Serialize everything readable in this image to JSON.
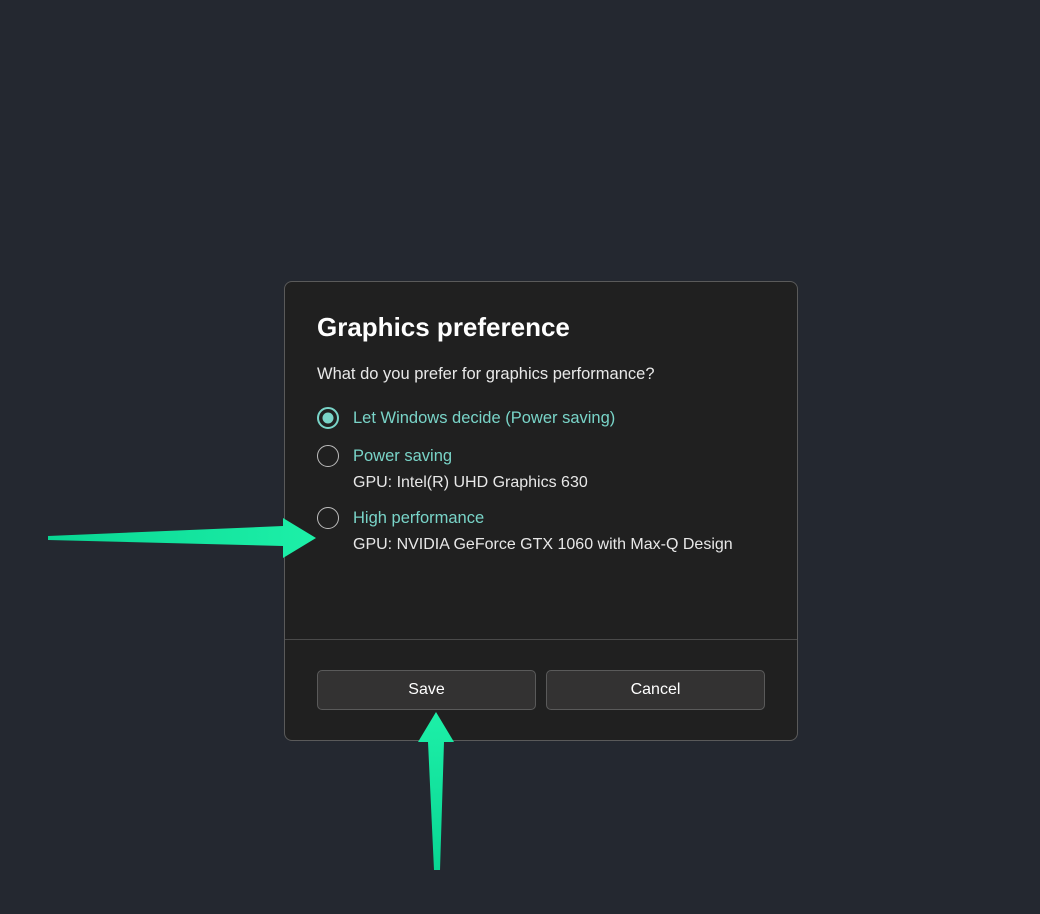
{
  "dialog": {
    "title": "Graphics preference",
    "question": "What do you prefer for graphics performance?",
    "options": [
      {
        "label": "Let Windows decide (Power saving)",
        "selected": true
      },
      {
        "label": "Power saving",
        "detail": "GPU: Intel(R) UHD Graphics 630",
        "selected": false
      },
      {
        "label": "High performance",
        "detail": "GPU: NVIDIA GeForce GTX 1060 with Max-Q Design",
        "selected": false
      }
    ],
    "save_label": "Save",
    "cancel_label": "Cancel"
  }
}
